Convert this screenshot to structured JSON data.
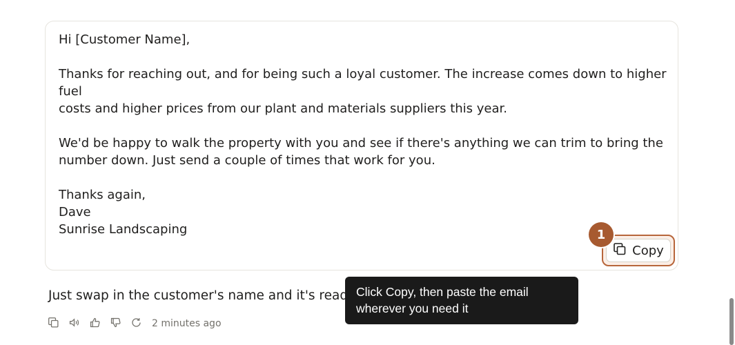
{
  "email": {
    "greeting": "Hi [Customer Name],",
    "para1_line1": "Thanks for reaching out, and for being such a loyal customer. The increase comes down to higher fuel",
    "para1_line2": "costs and higher prices from our plant and materials suppliers this year.",
    "para2_line1": "We'd be happy to walk the property with you and see if there's anything we can trim to bring the",
    "para2_line2": "number down. Just send a couple of times that work for you.",
    "signoff": "Thanks again,",
    "name": "Dave",
    "company": "Sunrise Landscaping"
  },
  "copy_button": {
    "label": "Copy",
    "icon": "copy-icon"
  },
  "step_badge": "1",
  "reply_text": "Just swap in the customer's name and it's ready",
  "tooltip": {
    "line1": "Click Copy, then paste the email",
    "line2": "wherever you need it"
  },
  "actions": {
    "icons": [
      "copy-icon",
      "speaker-icon",
      "thumbs-up-icon",
      "thumbs-down-icon",
      "retry-icon"
    ],
    "timestamp": "2 minutes ago"
  },
  "colors": {
    "accent": "#a75a30",
    "tooltip_bg": "#1a1a1a",
    "border": "#e6e4de"
  }
}
